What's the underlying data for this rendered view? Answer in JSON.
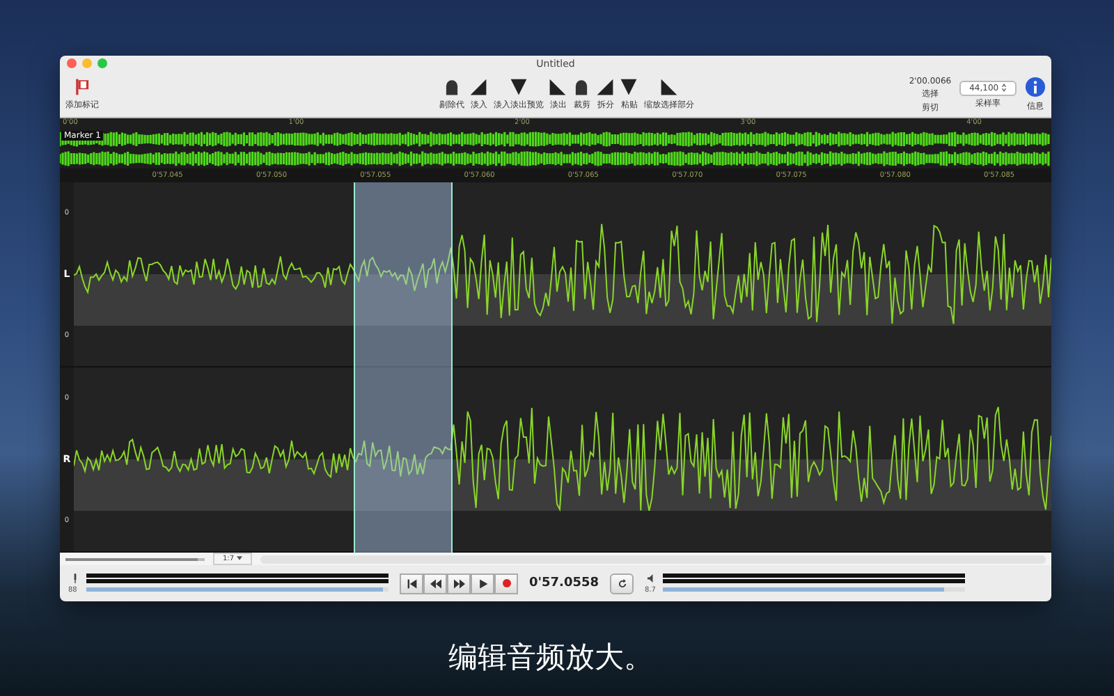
{
  "window": {
    "title": "Untitled"
  },
  "toolbar": {
    "left": {
      "label": "添加标记"
    },
    "tools": [
      {
        "label": "剔除代"
      },
      {
        "label": "淡入"
      },
      {
        "label": "淡入淡出预览"
      },
      {
        "label": "淡出"
      },
      {
        "label": "裁剪"
      },
      {
        "label": "拆分"
      },
      {
        "label": "粘贴"
      },
      {
        "label": "缩放选择部分"
      }
    ],
    "selection": {
      "value": "2'00.0066",
      "label": "选择",
      "caption": "剪切"
    },
    "sample_rate": {
      "value": "44,100",
      "label": "采样率"
    },
    "info": {
      "label": "信息"
    }
  },
  "overview": {
    "ticks": [
      "0'00",
      "1'00",
      "2'00",
      "3'00",
      "4'00"
    ],
    "marker": "Marker 1"
  },
  "ruler": [
    "0'57.045",
    "0'57.050",
    "0'57.055",
    "0'57.060",
    "0'57.065",
    "0'57.070",
    "0'57.075",
    "0'57.080",
    "0'57.085"
  ],
  "channels": [
    {
      "name": "L",
      "scale": [
        "0",
        "0"
      ]
    },
    {
      "name": "R",
      "scale": [
        "0",
        "0"
      ]
    }
  ],
  "zoom": {
    "level": 0.95,
    "value": "1:7"
  },
  "transport": {
    "time": "0'57.0558",
    "volume": {
      "label": "88",
      "level": 0.98
    },
    "rate": {
      "label": "8.7",
      "level": 0.93
    }
  },
  "caption": "编辑音频放大。"
}
